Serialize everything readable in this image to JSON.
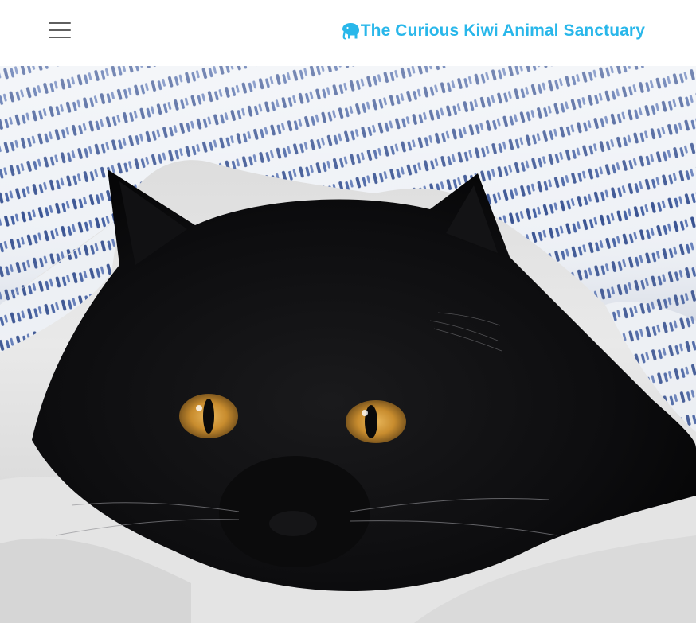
{
  "colors": {
    "brand": "#29b7ea",
    "menu_icon": "#5f5f5f",
    "navbar_bg": "#ffffff"
  },
  "navbar": {
    "menu_icon": "hamburger-menu-icon",
    "brand": {
      "icon": "elephant-icon",
      "text": "The Curious Kiwi Animal Sanctuary"
    }
  },
  "hero": {
    "image": "black-cat-under-striped-blanket"
  }
}
